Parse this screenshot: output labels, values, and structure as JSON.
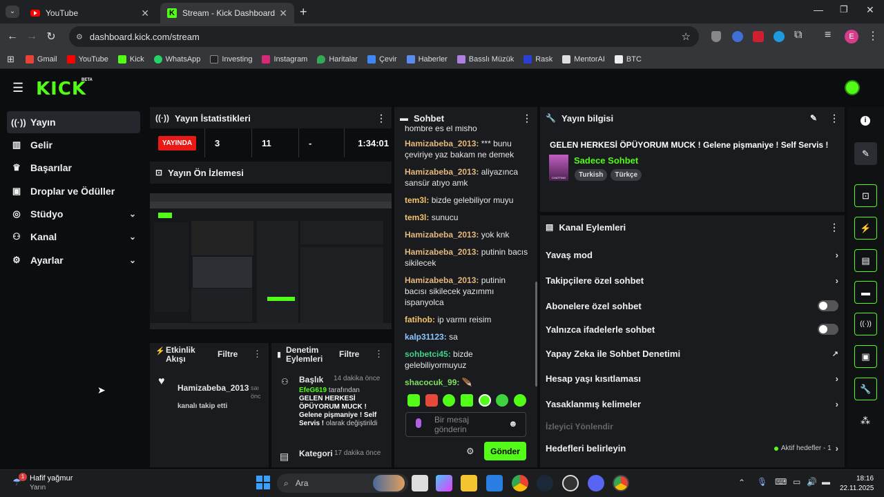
{
  "browser": {
    "tabs": [
      {
        "label": "YouTube"
      },
      {
        "label": "Stream - Kick Dashboard"
      }
    ],
    "url": "dashboard.kick.com/stream",
    "profile_initial": "E",
    "bookmarks": [
      "Gmail",
      "YouTube",
      "Kick",
      "WhatsApp",
      "Investing",
      "Instagram",
      "Haritalar",
      "Çevir",
      "Haberler",
      "Basslı Müzük",
      "Rask",
      "MentorAI",
      "BTC"
    ]
  },
  "kick": {
    "logo": "KICK",
    "beta": "BETA"
  },
  "sidebar": {
    "items": [
      {
        "label": "Yayın",
        "icon": "broadcast-icon"
      },
      {
        "label": "Gelir",
        "icon": "chart-icon"
      },
      {
        "label": "Başarılar",
        "icon": "trophy-icon"
      },
      {
        "label": "Droplar ve Ödüller",
        "icon": "gift-icon"
      },
      {
        "label": "Stüdyo",
        "icon": "camera-icon"
      },
      {
        "label": "Kanal",
        "icon": "users-icon"
      },
      {
        "label": "Ayarlar",
        "icon": "gear-icon"
      }
    ]
  },
  "stats": {
    "title": "Yayın İstatistikleri",
    "live": "YAYINDA",
    "viewers": "3",
    "followers": "11",
    "subs": "-",
    "uptime": "1:34:01"
  },
  "preview": {
    "title": "Yayın Ön İzlemesi"
  },
  "activity": {
    "title": "Etkinlik Akışı",
    "filter": "Filtre",
    "user": "Hamizabeba_2013",
    "suffix": "saı önc",
    "desc": "kanalı takip etti"
  },
  "mod": {
    "title": "Denetim Eylemleri",
    "filter": "Filtre",
    "items": [
      {
        "title": "Başlık",
        "time": "14 dakika önce",
        "user": "EfeG619",
        "by": "tarafından",
        "text": "GELEN HERKESİ ÖPÜYORUM MUCK ! Gelene pişmaniye ! Self Servis !",
        "suffix": "olarak değiştirildi"
      },
      {
        "title": "Kategori",
        "time": "17 dakika önce"
      }
    ]
  },
  "chat": {
    "title": "Sohbet",
    "messages": [
      {
        "user": "",
        "text": "hombre es el misho",
        "cls": ""
      },
      {
        "user": "Hamizabeba_2013:",
        "text": "*** bunu çeviriye yaz bakam ne demek",
        "cls": "u1"
      },
      {
        "user": "Hamizabeba_2013:",
        "text": "aliyazınca sansür atıyo amk",
        "cls": "u1"
      },
      {
        "user": "tem3l:",
        "text": "bizde gelebiliyor muyu",
        "cls": "u5"
      },
      {
        "user": "tem3l:",
        "text": "sunucu",
        "cls": "u5"
      },
      {
        "user": "Hamizabeba_2013:",
        "text": "yok knk",
        "cls": "u1"
      },
      {
        "user": "Hamizabeba_2013:",
        "text": "putinin bacıs sikilecek",
        "cls": "u1"
      },
      {
        "user": "Hamizabeba_2013:",
        "text": "putinin bacısı sikilecek yazımmı ispanyolca",
        "cls": "u1"
      },
      {
        "user": "fatihob:",
        "text": "ip varmı reisim",
        "cls": "u5"
      },
      {
        "user": "kalp31123:",
        "text": "sa",
        "cls": "u3"
      },
      {
        "user": "sohbetci45:",
        "text": "bizde gelebiliyormuyuz",
        "cls": "u4"
      },
      {
        "user": "shacocuk_99:",
        "text": "",
        "cls": "u2"
      }
    ],
    "placeholder": "Bir mesaj gönderin",
    "send": "Gönder"
  },
  "info": {
    "title": "Yayın bilgisi",
    "stream_title": "GELEN HERKESİ ÖPÜYORUM MUCK ! Gelene pişmaniye ! Self Servis !",
    "category": "Sadece Sohbet",
    "tags": [
      "Turkish",
      "Türkçe"
    ],
    "thumb_text": "CHATTING"
  },
  "actions": {
    "title": "Kanal Eylemleri",
    "rows": [
      {
        "label": "Yavaş mod",
        "kind": "chevron"
      },
      {
        "label": "Takipçilere özel sohbet",
        "kind": "chevron"
      },
      {
        "label": "Abonelere özel sohbet",
        "kind": "toggle"
      },
      {
        "label": "Yalnızca ifadelerle sohbet",
        "kind": "toggle"
      },
      {
        "label": "Yapay Zeka ile Sohbet Denetimi",
        "kind": "external"
      },
      {
        "label": "Hesap yaşı kısıtlaması",
        "kind": "chevron"
      },
      {
        "label": "Yasaklanmış kelimeler",
        "kind": "chevron"
      }
    ],
    "section": "İzleyici Yönlendir",
    "goals": "Hedefleri belirleyin",
    "goals_status": "Aktif hedefler - 1"
  },
  "taskbar": {
    "weather_title": "Hafif yağmur",
    "weather_sub": "Yarın",
    "search": "Ara",
    "time": "18:16",
    "date": "22.11.2025",
    "badge": "1"
  },
  "colors": {
    "kick_green": "#53fc18",
    "live_red": "#e91916"
  }
}
